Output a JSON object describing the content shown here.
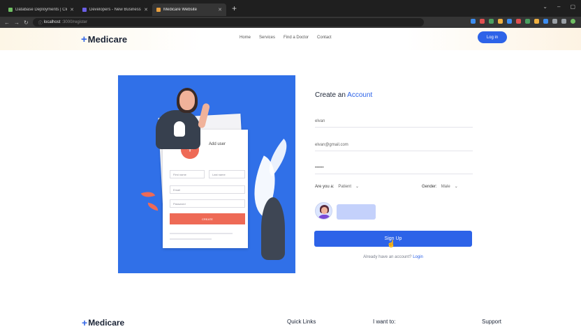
{
  "browser": {
    "tabs": [
      {
        "title": "Database Deployments | Cloud",
        "favicon_color": "#6fbf63",
        "active": false
      },
      {
        "title": "Developers - New Business - St",
        "favicon_color": "#6b5fe6",
        "active": false
      },
      {
        "title": "Medicare Website",
        "favicon_color": "#e8a040",
        "active": true
      }
    ],
    "new_tab": "+",
    "address": {
      "host": "localhost",
      "path": ":3000/register"
    },
    "extension_colors": [
      "#3c8df0",
      "#e05050",
      "#4aa060",
      "#f0b040",
      "#3c8df0",
      "#e05050",
      "#4aa060",
      "#f0b040",
      "#3c8df0",
      "#9aa0a6",
      "#9aa0a6",
      "#9aa0a6"
    ]
  },
  "header": {
    "logo": "Medicare",
    "nav": [
      "Home",
      "Services",
      "Find a Doctor",
      "Contact"
    ],
    "login": "Log in"
  },
  "illustration": {
    "card_title": "Add user",
    "fields": {
      "first_name": "First name",
      "last_name": "Last name",
      "email": "Email",
      "password": "Password"
    },
    "button": "CREATE"
  },
  "form": {
    "title_part1": "Create an ",
    "title_part2": "Account",
    "name_value": "elvan",
    "email_value": "elvan@gmail.com",
    "password_value": "••••••",
    "role_label": "Are you a:",
    "role_value": "Patient",
    "gender_label": "Gender:",
    "gender_value": "Male",
    "signup": "Sign Up",
    "already_text": "Already have an account? ",
    "login_link": "Login"
  },
  "footer": {
    "logo": "Medicare",
    "quick_links": "Quick Links",
    "i_want_to": "I want to:",
    "support": "Support"
  },
  "colors": {
    "primary": "#2d63e8",
    "illustration_bg": "#3070e8",
    "accent_red": "#ee6a56"
  }
}
